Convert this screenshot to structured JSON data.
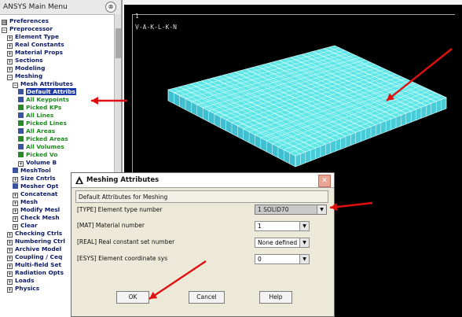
{
  "main_menu": {
    "title": "ANSYS Main Menu",
    "collapse_icon": "collapse-up-icon",
    "items": [
      {
        "label": "Preferences",
        "marker": "folder",
        "indent": 0
      },
      {
        "label": "Preprocessor",
        "marker": "minus",
        "indent": 0
      },
      {
        "label": "Element Type",
        "marker": "plus",
        "indent": 1
      },
      {
        "label": "Real Constants",
        "marker": "plus",
        "indent": 1
      },
      {
        "label": "Material Props",
        "marker": "plus",
        "indent": 1
      },
      {
        "label": "Sections",
        "marker": "plus",
        "indent": 1
      },
      {
        "label": "Modeling",
        "marker": "plus",
        "indent": 1
      },
      {
        "label": "Meshing",
        "marker": "minus",
        "indent": 1
      },
      {
        "label": "Mesh Attributes",
        "marker": "minus",
        "indent": 2
      },
      {
        "label": "Default Attribs",
        "marker": "square",
        "indent": 3,
        "selected": true
      },
      {
        "label": "All Keypoints",
        "marker": "square",
        "indent": 3,
        "green": true
      },
      {
        "label": "Picked KPs",
        "marker": "pick",
        "indent": 3,
        "green": true
      },
      {
        "label": "All Lines",
        "marker": "square",
        "indent": 3,
        "green": true
      },
      {
        "label": "Picked Lines",
        "marker": "pick",
        "indent": 3,
        "green": true
      },
      {
        "label": "All Areas",
        "marker": "square",
        "indent": 3,
        "green": true
      },
      {
        "label": "Picked Areas",
        "marker": "pick",
        "indent": 3,
        "green": true
      },
      {
        "label": "All Volumes",
        "marker": "square",
        "indent": 3,
        "green": true
      },
      {
        "label": "Picked Vo",
        "marker": "pick",
        "indent": 3,
        "green": true
      },
      {
        "label": "Volume B",
        "marker": "plus",
        "indent": 3
      },
      {
        "label": "MeshTool",
        "marker": "square",
        "indent": 2
      },
      {
        "label": "Size Cntrls",
        "marker": "plus",
        "indent": 2
      },
      {
        "label": "Mesher Opt",
        "marker": "square",
        "indent": 2
      },
      {
        "label": "Concatenat",
        "marker": "plus",
        "indent": 2
      },
      {
        "label": "Mesh",
        "marker": "plus",
        "indent": 2
      },
      {
        "label": "Modify Mesl",
        "marker": "plus",
        "indent": 2
      },
      {
        "label": "Check Mesh",
        "marker": "plus",
        "indent": 2
      },
      {
        "label": "Clear",
        "marker": "plus",
        "indent": 2
      },
      {
        "label": "Checking Ctrls",
        "marker": "plus",
        "indent": 1
      },
      {
        "label": "Numbering Ctrl",
        "marker": "plus",
        "indent": 1
      },
      {
        "label": "Archive Model",
        "marker": "plus",
        "indent": 1
      },
      {
        "label": "Coupling / Ceq",
        "marker": "plus",
        "indent": 1
      },
      {
        "label": "Multi-field Set",
        "marker": "plus",
        "indent": 1
      },
      {
        "label": "Radiation Opts",
        "marker": "plus",
        "indent": 1
      },
      {
        "label": "Loads",
        "marker": "plus",
        "indent": 1
      },
      {
        "label": "Physics",
        "marker": "plus",
        "indent": 1
      }
    ]
  },
  "graphics": {
    "window_number": "1",
    "view_label": "V-A-K-L-K-N",
    "mesh_color": "#5ee6e6",
    "mesh_line_color": "#e8ffff",
    "background": "#000000"
  },
  "dialog": {
    "title": "Meshing Attributes",
    "heading": "Default Attributes for Meshing",
    "close_icon": "close-icon",
    "fields": [
      {
        "label": "[TYPE]  Element type number",
        "value": "1    SOLID70",
        "control": "dropdown",
        "disabled": true
      },
      {
        "label": "[MAT]  Material number",
        "value": "1",
        "control": "dropdown"
      },
      {
        "label": "[REAL]  Real constant set number",
        "value": "None defined",
        "control": "dropdown"
      },
      {
        "label": "[ESYS]  Element coordinate sys",
        "value": "0",
        "control": "dropdown"
      }
    ],
    "buttons": {
      "ok": "OK",
      "cancel": "Cancel",
      "help": "Help"
    }
  },
  "annotations": {
    "arrow_color": "#e01010"
  }
}
